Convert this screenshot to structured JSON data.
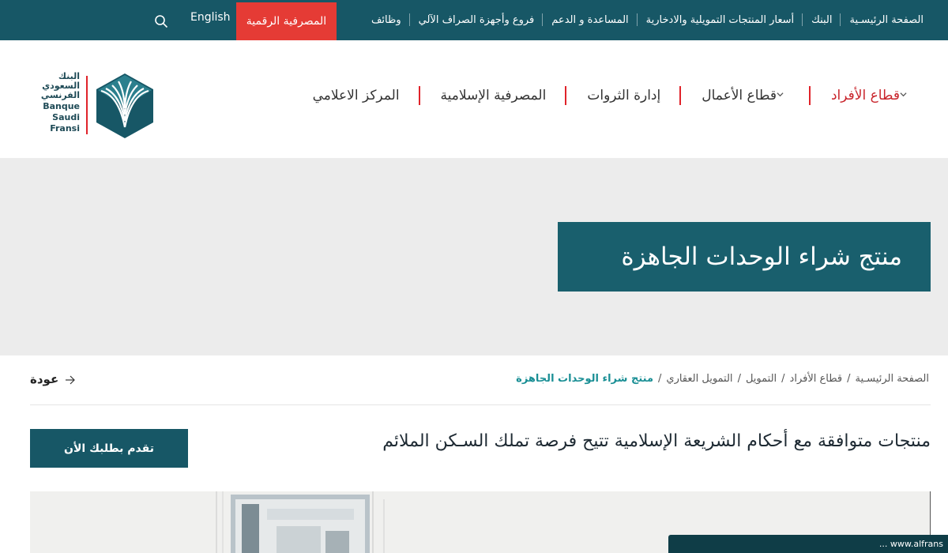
{
  "topbar": {
    "items": [
      "الصفحة الرئيسـية",
      "البنك",
      "أسعار المنتجات التمويلية والادخارية",
      "المساعدة و الدعم",
      "فروع وأجهزة الصراف الآلي",
      "وظائف"
    ],
    "digital_banking": "المصرفية الرقمية",
    "language": "English",
    "search_icon": "search-icon"
  },
  "logo": {
    "arabic": [
      "البنك",
      "السعودي",
      "الفرنسي"
    ],
    "english": [
      "Banque",
      "Saudi",
      "Fransi"
    ]
  },
  "main_nav": {
    "items": [
      "قطاع الأفراد",
      "قطاع الأعمال",
      "إدارة الثروات",
      "المصرفية الإسلامية",
      "المركز الاعلامي"
    ]
  },
  "hero": {
    "title": "منتج شراء الوحدات الجاهزة"
  },
  "breadcrumb": {
    "items": [
      "الصفحة الرئيسـية",
      "قطاع الأفراد",
      "التمويل",
      "التمويل العقاري",
      "منتج شراء الوحدات الجاهزة"
    ],
    "separator": "/"
  },
  "back": {
    "label": "عودة"
  },
  "intro": {
    "text": "منتجات متوافقة مع أحكام الشريعة الإسلامية تتيح فرصة تملك السـكن الملائم"
  },
  "apply_button": {
    "label": "تقدم بطلبك الأن"
  },
  "bottom_bar": {
    "text": "... www.alfrans"
  },
  "colors": {
    "brand_teal": "#175766",
    "accent_red": "#e53b35",
    "active_red": "#c9252c",
    "crumb_teal": "#1a8f95"
  }
}
